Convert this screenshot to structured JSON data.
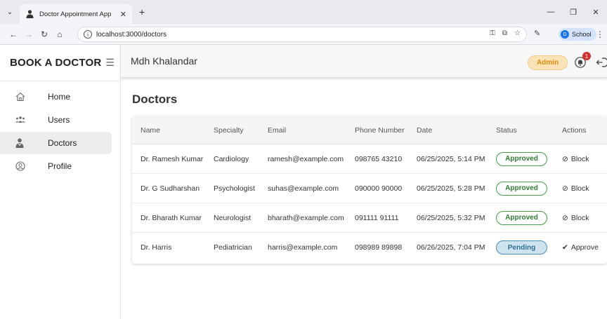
{
  "browser": {
    "tab_title": "Doctor Appointment App",
    "url": "localhost:3000/doctors",
    "profile_label": "School",
    "profile_initial": "D"
  },
  "sidebar": {
    "brand": "BOOK A DOCTOR",
    "items": [
      {
        "label": "Home",
        "icon": "home-icon"
      },
      {
        "label": "Users",
        "icon": "users-icon"
      },
      {
        "label": "Doctors",
        "icon": "doctor-icon"
      },
      {
        "label": "Profile",
        "icon": "profile-icon"
      }
    ],
    "active": "Doctors"
  },
  "header": {
    "user_name": "Mdh Khalandar",
    "role_badge": "Admin",
    "notification_count": "1"
  },
  "main": {
    "title": "Doctors",
    "columns": [
      "Name",
      "Specialty",
      "Email",
      "Phone Number",
      "Date",
      "Status",
      "Actions"
    ],
    "rows": [
      {
        "name": "Dr. Ramesh Kumar",
        "specialty": "Cardiology",
        "email": "ramesh@example.com",
        "phone": "098765 43210",
        "date": "06/25/2025, 5:14 PM",
        "status": "Approved",
        "action": "Block"
      },
      {
        "name": "Dr. G Sudharshan",
        "specialty": "Psychologist",
        "email": "suhas@example.com",
        "phone": "090000 90000",
        "date": "06/25/2025, 5:28 PM",
        "status": "Approved",
        "action": "Block"
      },
      {
        "name": "Dr. Bharath Kumar",
        "specialty": "Neurologist",
        "email": "bharath@example.com",
        "phone": "091111 91111",
        "date": "06/25/2025, 5:32 PM",
        "status": "Approved",
        "action": "Block"
      },
      {
        "name": "Dr. Harris",
        "specialty": "Pediatrician",
        "email": "harris@example.com",
        "phone": "098989 89898",
        "date": "06/26/2025, 7:04 PM",
        "status": "Pending",
        "action": "Approve"
      }
    ]
  },
  "colors": {
    "approved": "#2e7d32",
    "pending": "#2f6f93",
    "admin_badge": "#e08c0a",
    "notification": "#d32f2f"
  }
}
